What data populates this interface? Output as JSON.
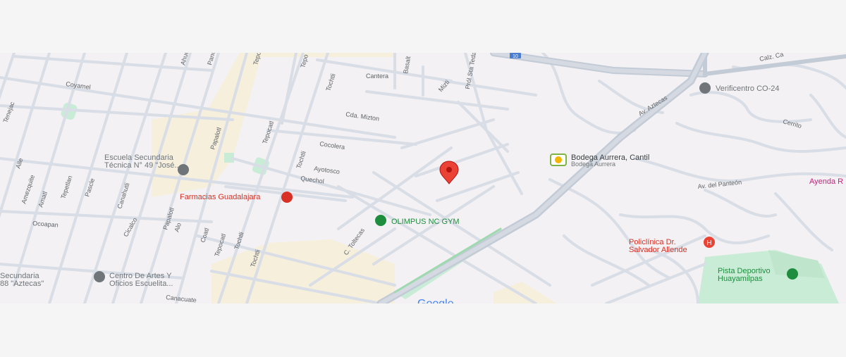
{
  "colors": {
    "background": "#f3f1f3",
    "road": "#d8dde6",
    "highway": "#c3cbd6",
    "park": "#c9ecd6",
    "commercial": "#f6efdc",
    "pin": "#ea4335",
    "poi_gray": "#70757a",
    "poi_green": "#1e8e3e",
    "poi_red": "#d93025",
    "poi_pink": "#c5227f"
  },
  "streets": {
    "coyamel": "Coyamel",
    "tenejac": "Tenejac",
    "alle": "Alle",
    "amezquite": "Amezquite",
    "amatl": "Amatl",
    "tepetlan": "Tepetlan",
    "pasle": "Pascle",
    "ocoapan": "Ocoapan",
    "canahutli": "Canahutli",
    "papalotl": "Papalotl",
    "papalotl2": "Papalotl",
    "tepocatl": "Tepocatl",
    "tepocatl2": "Tepocatl",
    "tochtli": "Tochtli",
    "tochtli2": "Tochtli",
    "tochtli3": "Tochtli",
    "tochtli4": "Tochtli",
    "coatl": "Coatl",
    "alo": "Alo",
    "cicalco": "Cicalco",
    "cda_mizton": "Cda. Mizton",
    "cocolera": "Cocolera",
    "ayotosco": "Ayotosco",
    "quechol": "Quechol",
    "cantera": "Cantera",
    "basalt": "Basalt",
    "mizti": "Mizti",
    "piedra": "Pról Sta Teda",
    "av_aztecas": "Av. Aztecas",
    "c_toltecas": "C. Toltecas",
    "av_panteon": "Av. del Panteón",
    "cerrito": "Cerrito",
    "calz": "Calz. Ca",
    "canacuate": "Canacuate",
    "ahue": "Ahue",
    "panc": "Panc",
    "tepoz": "Tepoz",
    "tepo": "Tepo",
    "highway_shield": "10"
  },
  "pois": {
    "escuela": "Escuela Secundaria\nTécnica N° 49 \"José...",
    "farmacias": "Farmacias Guadalajara",
    "olimpus": "OLIMPUS NC GYM",
    "centro_artes": "Centro De Artes Y\nOficios Escuelita...",
    "secundaria88": "Secundaria\n88 \"Aztecas\"",
    "bodega": "Bodega Aurrera, Cantil",
    "bodega_sub": "Bodega Aurrera",
    "verificentro": "Verificentro CO-24",
    "policlinica": "Policlínica Dr.\nSalvador Allende",
    "pista": "Pista Deportivo\nHuayamilpas",
    "ayenda": "Ayenda R"
  },
  "google_logo": "Google"
}
